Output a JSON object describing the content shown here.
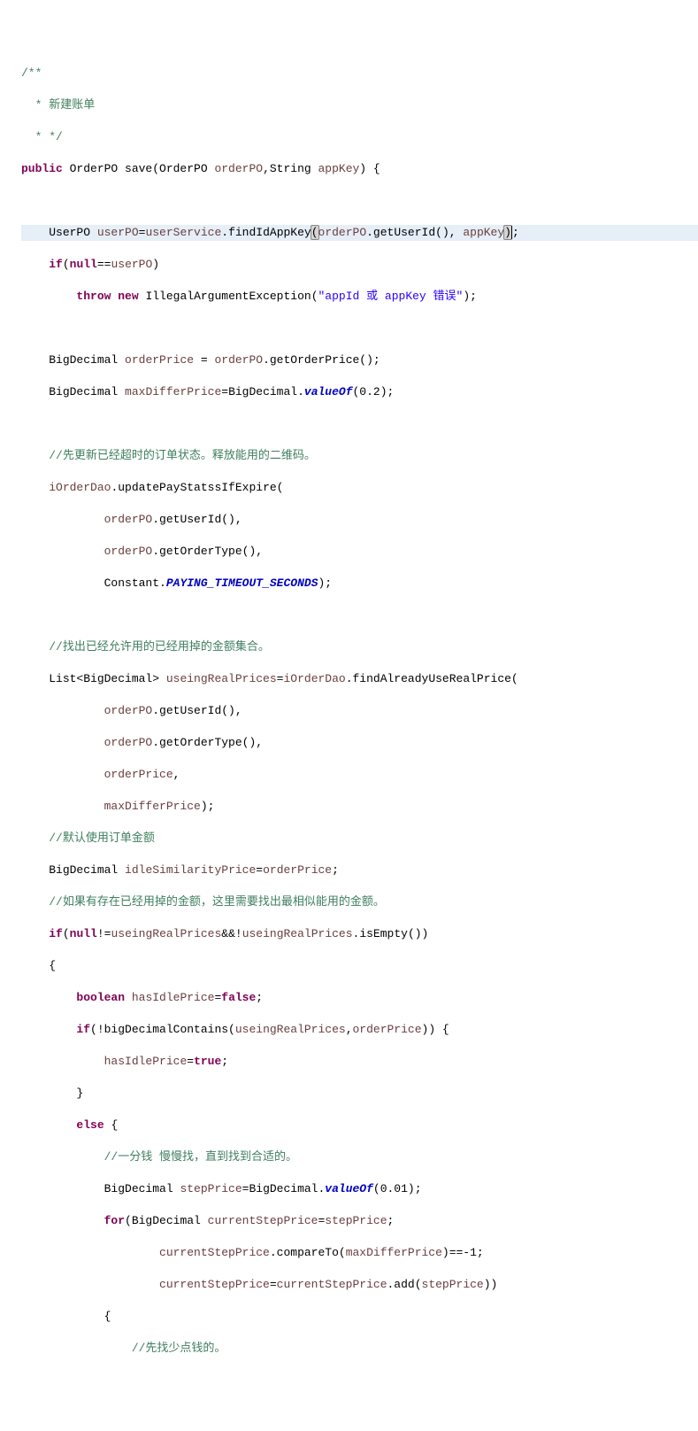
{
  "code": {
    "t01": "/**",
    "t02": " * 新建账单",
    "t03": " * */",
    "t04a": "public",
    "t04b": " OrderPO save(OrderPO ",
    "t04c": "orderPO",
    "t04d": ",String ",
    "t04e": "appKey",
    "t04f": ") {",
    "t05a": "UserPO ",
    "t05b": "userPO",
    "t05c": "=",
    "t05d": "userService",
    "t05e": ".findIdAppKey",
    "t05f": "(",
    "t05g": "orderPO",
    "t05h": ".getUserId(), ",
    "t05i": "appKey",
    "t05j": ")",
    "t05k": ";",
    "t06a": "if",
    "t06b": "(",
    "t06c": "null",
    "t06d": "==",
    "t06e": "userPO",
    "t06f": ")",
    "t07a": "throw",
    "t07b": "new",
    "t07c": " IllegalArgumentException(",
    "t07d": "\"appId 或 appKey 错误\"",
    "t07e": ");",
    "t08a": "BigDecimal ",
    "t08b": "orderPrice",
    "t08c": " = ",
    "t08d": "orderPO",
    "t08e": ".getOrderPrice();",
    "t09a": "BigDecimal ",
    "t09b": "maxDifferPrice",
    "t09c": "=BigDecimal.",
    "t09d": "valueOf",
    "t09e": "(0.2);",
    "t10": "//先更新已经超时的订单状态。释放能用的二维码。",
    "t11a": "iOrderDao",
    "t11b": ".updatePayStatssIfExpire(",
    "t12a": "orderPO",
    "t12b": ".getUserId(),",
    "t13a": "orderPO",
    "t13b": ".getOrderType(),",
    "t14a": "Constant.",
    "t14b": "PAYING_TIMEOUT_SECONDS",
    "t14c": ");",
    "t15": "//找出已经允许用的已经用掉的金额集合。",
    "t16a": "List<BigDecimal> ",
    "t16b": "useingRealPrices",
    "t16c": "=",
    "t16d": "iOrderDao",
    "t16e": ".findAlreadyUseRealPrice(",
    "t17a": "orderPO",
    "t17b": ".getUserId(),",
    "t18a": "orderPO",
    "t18b": ".getOrderType(),",
    "t19a": "orderPrice",
    "t19b": ",",
    "t20a": "maxDifferPrice",
    "t20b": ");",
    "t21": "//默认使用订单金额",
    "t22a": "BigDecimal ",
    "t22b": "idleSimilarityPrice",
    "t22c": "=",
    "t22d": "orderPrice",
    "t22e": ";",
    "t23": "//如果有存在已经用掉的金额，这里需要找出最相似能用的金额。",
    "t24a": "if",
    "t24b": "(",
    "t24c": "null",
    "t24d": "!=",
    "t24e": "useingRealPrices",
    "t24f": "&&!",
    "t24g": "useingRealPrices",
    "t24h": ".isEmpty())",
    "t25": "{",
    "t26a": "boolean",
    "t26b": "hasIdlePrice",
    "t26c": "=",
    "t26d": "false",
    "t26e": ";",
    "t27a": "if",
    "t27b": "(!bigDecimalContains(",
    "t27c": "useingRealPrices",
    "t27d": ",",
    "t27e": "orderPrice",
    "t27f": ")) {",
    "t28a": "hasIdlePrice",
    "t28b": "=",
    "t28c": "true",
    "t28d": ";",
    "t29": "}",
    "t30a": "else",
    "t30b": " {",
    "t31": "//一分钱 慢慢找，直到找到合适的。",
    "t32a": "BigDecimal ",
    "t32b": "stepPrice",
    "t32c": "=BigDecimal.",
    "t32d": "valueOf",
    "t32e": "(0.01);",
    "t33a": "for",
    "t33b": "(BigDecimal ",
    "t33c": "currentStepPrice",
    "t33d": "=",
    "t33e": "stepPrice",
    "t33f": ";",
    "t34a": "currentStepPrice",
    "t34b": ".compareTo(",
    "t34c": "maxDifferPrice",
    "t34d": ")==-1;",
    "t35a": "currentStepPrice",
    "t35b": "=",
    "t35c": "currentStepPrice",
    "t35d": ".add(",
    "t35e": "stepPrice",
    "t35f": "))",
    "t36": "{",
    "t37": "//先找少点钱的。"
  }
}
